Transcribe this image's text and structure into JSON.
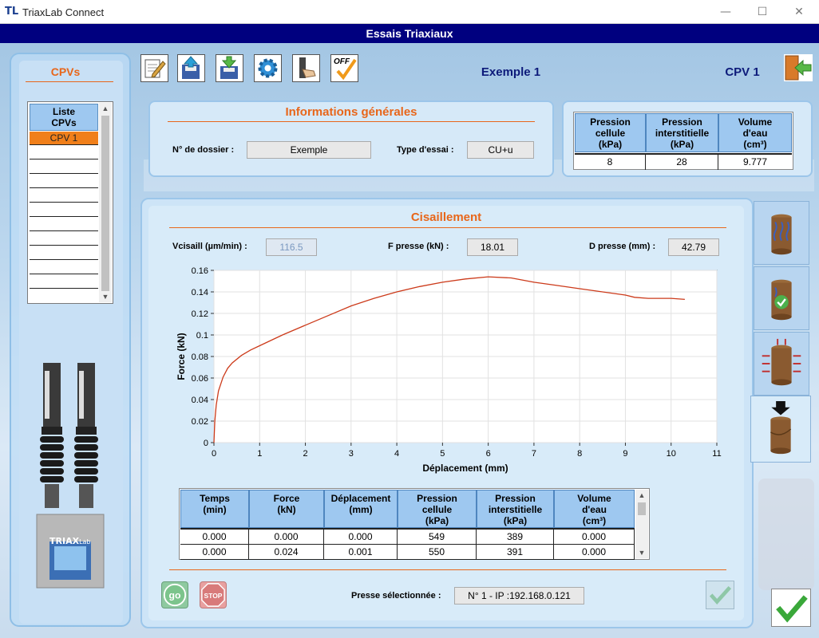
{
  "window": {
    "title": "TriaxLab Connect",
    "minimize": "—",
    "maximize": "☐",
    "close": "✕"
  },
  "header": {
    "title": "Essais Triaxiaux"
  },
  "left": {
    "title": "CPVs",
    "list_header": "Liste CPVs",
    "items": [
      "CPV 1"
    ]
  },
  "device": {
    "brand": "TRIAX",
    "brand_sub": "Lab"
  },
  "toolbar": {
    "exemple_label": "Exemple 1",
    "cpv_label": "CPV 1",
    "off_label": "OFF",
    "icons": [
      "edit-icon",
      "save-upload-icon",
      "download-icon",
      "settings-gear-icon",
      "hand-lever-icon",
      "off-check-icon"
    ]
  },
  "info": {
    "title": "Informations générales",
    "dossier_label": "N° de dossier :",
    "dossier_value": "Exemple",
    "type_label": "Type d'essai :",
    "type_value": "CU+u"
  },
  "pressure_table": {
    "headers": [
      "Pression cellule (kPa)",
      "Pression interstitielle (kPa)",
      "Volume d'eau (cm³)"
    ],
    "h1": [
      "Pression",
      "cellule",
      "(kPa)"
    ],
    "h2": [
      "Pression",
      "interstitielle",
      "(kPa)"
    ],
    "h3": [
      "Volume",
      "d'eau",
      "(cm³)"
    ],
    "values": [
      "8",
      "28",
      "9.777"
    ]
  },
  "shear": {
    "title": "Cisaillement",
    "vcis_label": "Vcisaill (µm/min) :",
    "vcis_value": "116.5",
    "fpresse_label": "F presse (kN) :",
    "fpresse_value": "18.01",
    "dpresse_label": "D presse (mm) :",
    "dpresse_value": "42.79"
  },
  "chart_data": {
    "type": "line",
    "xlabel": "Déplacement (mm)",
    "ylabel": "Force (kN)",
    "xlim": [
      0,
      11
    ],
    "ylim": [
      0,
      0.16
    ],
    "xticks": [
      "0",
      "1",
      "2",
      "3",
      "4",
      "5",
      "6",
      "7",
      "8",
      "9",
      "10",
      "11"
    ],
    "yticks": [
      "0",
      "0.02",
      "0.04",
      "0.06",
      "0.08",
      "0.1",
      "0.12",
      "0.14",
      "0.16"
    ],
    "grid": true,
    "color": "#cc3a1a",
    "series": [
      {
        "x": [
          0,
          0.02,
          0.05,
          0.1,
          0.2,
          0.3,
          0.4,
          0.6,
          0.8,
          1.0,
          1.5,
          2.0,
          2.5,
          3.0,
          3.5,
          4.0,
          4.5,
          5.0,
          5.5,
          6.0,
          6.5,
          7.0,
          7.5,
          8.0,
          8.5,
          9.0,
          9.2,
          9.5,
          10.0,
          10.3
        ],
        "y": [
          0,
          0.02,
          0.035,
          0.048,
          0.061,
          0.069,
          0.074,
          0.081,
          0.086,
          0.09,
          0.1,
          0.109,
          0.118,
          0.127,
          0.134,
          0.14,
          0.145,
          0.149,
          0.152,
          0.154,
          0.153,
          0.149,
          0.146,
          0.143,
          0.14,
          0.137,
          0.135,
          0.134,
          0.134,
          0.133
        ]
      }
    ]
  },
  "data_table": {
    "h_temps": [
      "Temps",
      "(min)"
    ],
    "h_force": [
      "Force",
      "(kN)"
    ],
    "h_depl": [
      "Déplacement",
      "(mm)"
    ],
    "h_pcell": [
      "Pression",
      "cellule",
      "(kPa)"
    ],
    "h_pint": [
      "Pression",
      "interstitielle",
      "(kPa)"
    ],
    "h_vol": [
      "Volume",
      "d'eau",
      "(cm³)"
    ],
    "rows": [
      [
        "0.000",
        "0.000",
        "0.000",
        "549",
        "389",
        "0.000"
      ],
      [
        "0.000",
        "0.024",
        "0.001",
        "550",
        "391",
        "0.000"
      ]
    ]
  },
  "footer": {
    "go_label": "go",
    "stop_label": "STOP",
    "presse_label": "Presse sélectionnée :",
    "presse_value": "N° 1 - IP :192.168.0.121"
  },
  "side_tabs": [
    "sample-saturation-icon",
    "sample-consolidation-check-icon",
    "sample-pressure-icon",
    "sample-shear-icon"
  ],
  "colors": {
    "accent": "#e8661a",
    "header_bg": "#00007f",
    "table_header": "#9ec8f0",
    "selected_row": "#f07f1a",
    "curve": "#cc3a1a"
  }
}
